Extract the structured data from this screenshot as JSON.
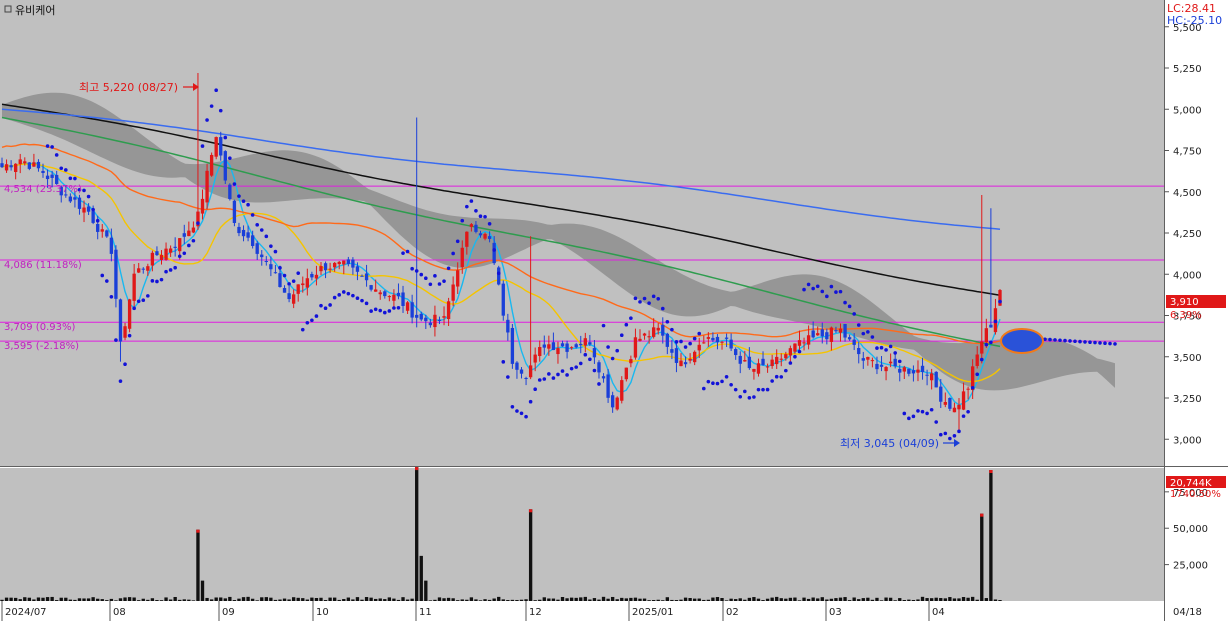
{
  "stock_name": "유비케어",
  "lc_text": "LC:28.41",
  "hc_text": "HC:-25.10",
  "chart_data": {
    "type": "candlestick",
    "title": "유비케어",
    "y_axis": {
      "min": 2850,
      "max": 5650,
      "ticks": [
        "5,500",
        "5,250",
        "5,000",
        "4,750",
        "4,500",
        "4,250",
        "4,000",
        "3,750",
        "3,500",
        "3,250",
        "3,000"
      ],
      "tick_values": [
        5500,
        5250,
        5000,
        4750,
        4500,
        4250,
        4000,
        3750,
        3500,
        3250,
        3000
      ]
    },
    "x_axis": {
      "labels": [
        "2024/07",
        "08",
        "09",
        "10",
        "11",
        "12",
        "2025/01",
        "02",
        "03",
        "04",
        "04/18"
      ]
    },
    "last_price_label": "3,910",
    "last_change_label": "6.39%",
    "levels": [
      {
        "label": "4,534 (23.37%)",
        "value": 4534
      },
      {
        "label": "4,086 (11.18%)",
        "value": 4086
      },
      {
        "label": "3,709 (0.93%)",
        "value": 3709
      },
      {
        "label": "3,595 (-2.18%)",
        "value": 3595
      }
    ],
    "annotations": {
      "high": {
        "label": "최고 5,220 (08/27)",
        "value": 5220
      },
      "low": {
        "label": "최저 3,045 (04/09)",
        "value": 3045
      }
    },
    "volume_panel": {
      "y_ticks": [
        "75,000",
        "50,000",
        "25,000"
      ],
      "y_tick_values": [
        75000,
        50000,
        25000
      ],
      "last_volume_label": "20,744K",
      "last_volume_pct": "1740.50%"
    },
    "series_colors": {
      "up": "#e01818",
      "down": "#1a3fd8",
      "ma5": "#18b8f0",
      "ma20": "#f5c400",
      "ma60": "#ff6a1a",
      "ma120": "#2e9c4e",
      "ma240": "#111111",
      "ma480": "#3a6cf0",
      "sar": "#1212d8",
      "cloud": "#8e8e8e",
      "level_line": "#e01ee0"
    }
  }
}
